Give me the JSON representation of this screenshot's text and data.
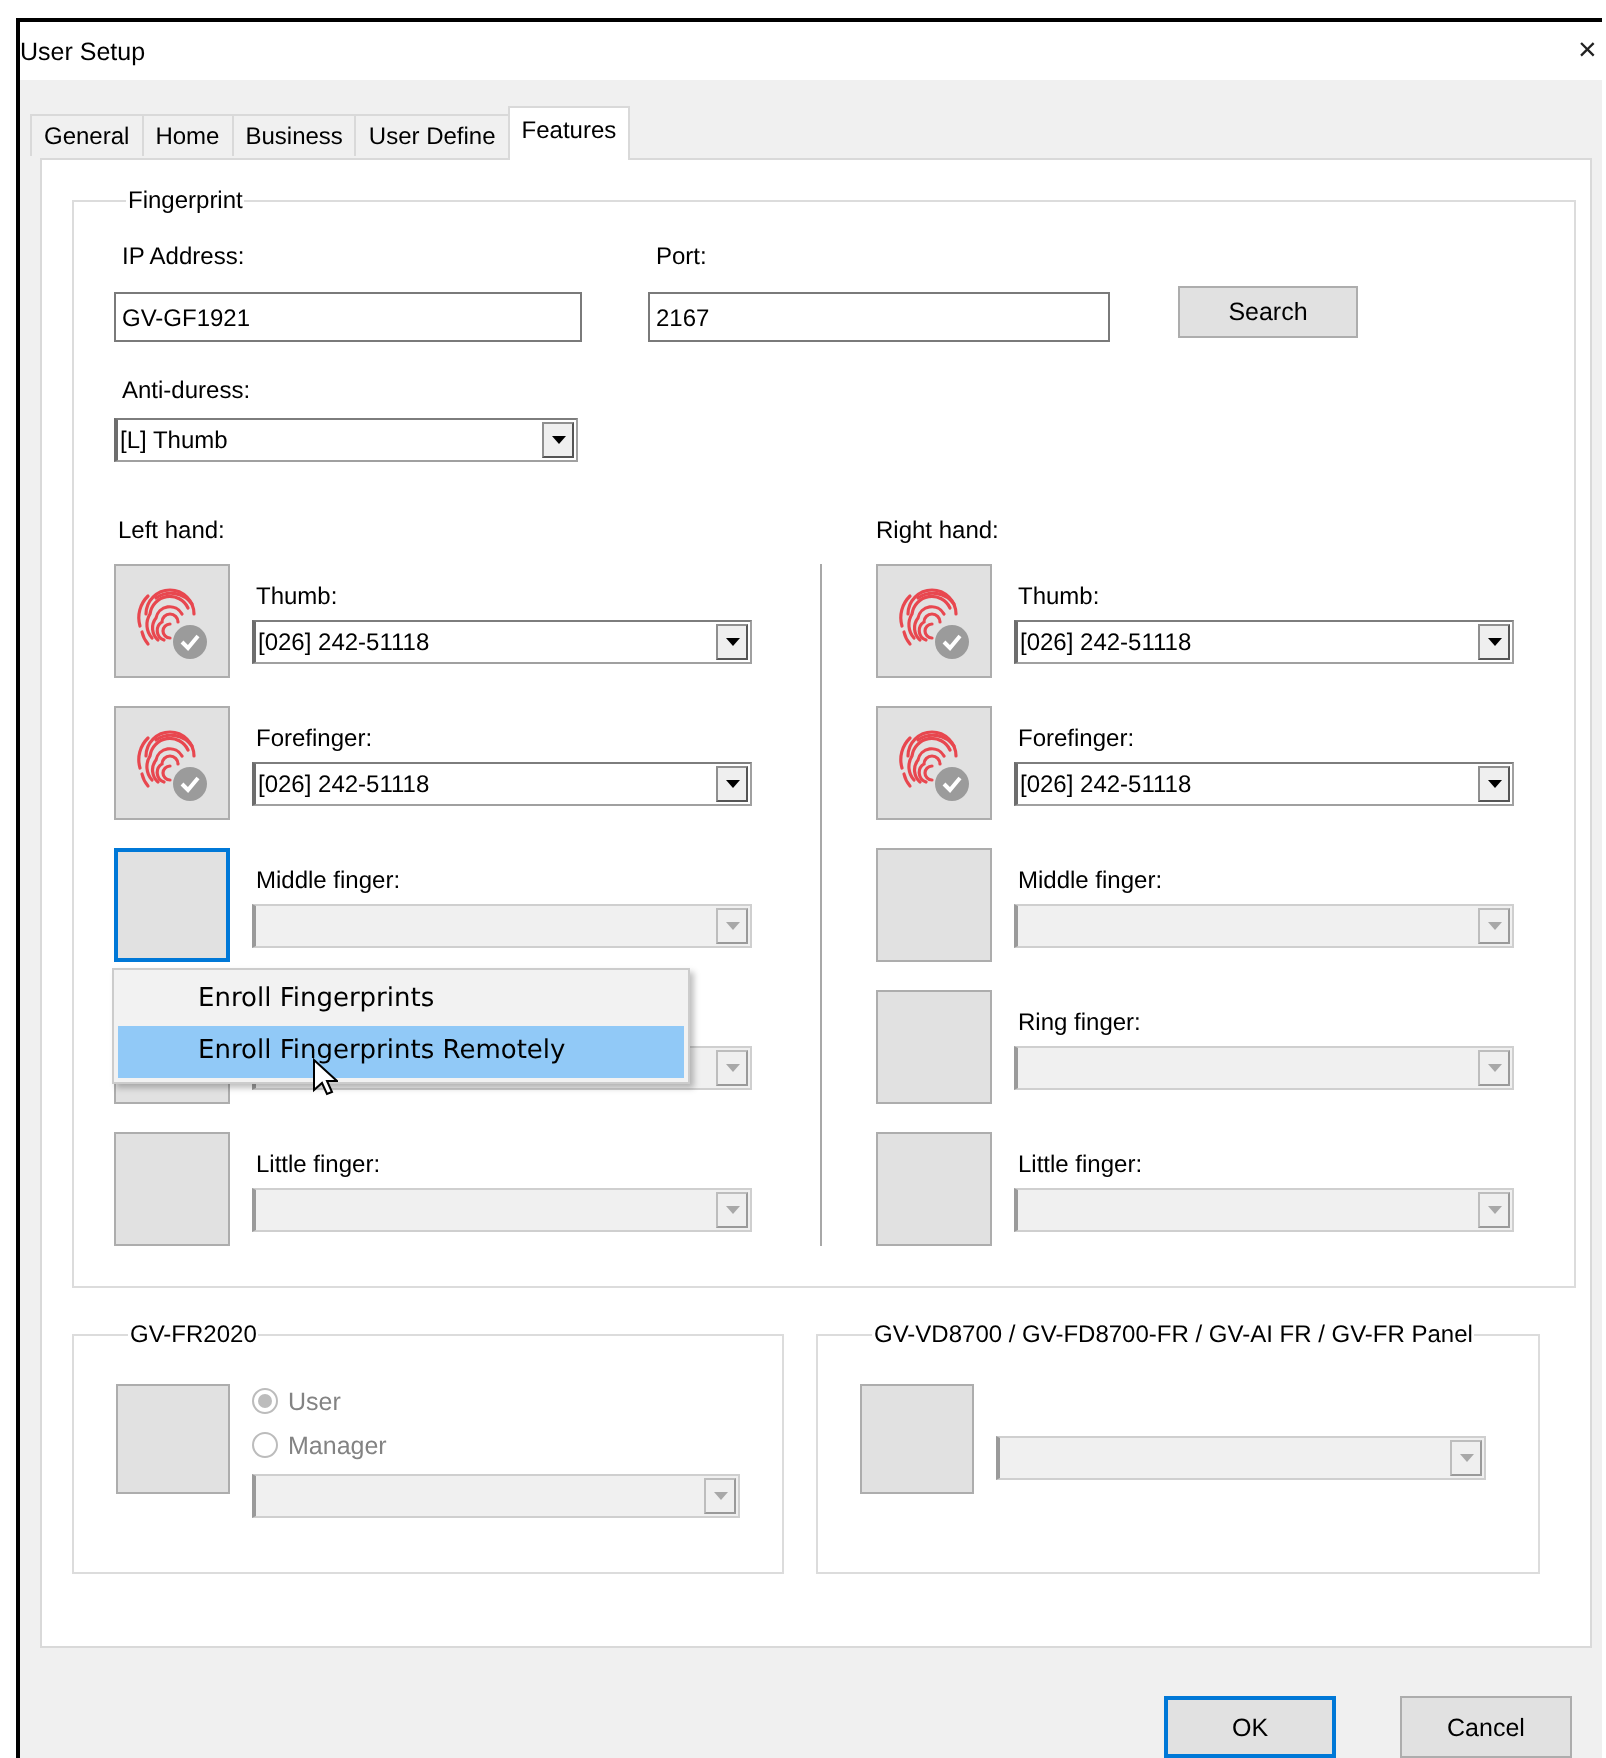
{
  "window": {
    "title": "User Setup",
    "close": "×"
  },
  "tabs": [
    {
      "label": "General",
      "selected": false
    },
    {
      "label": "Home",
      "selected": false
    },
    {
      "label": "Business",
      "selected": false
    },
    {
      "label": "User Define",
      "selected": false
    },
    {
      "label": "Features",
      "selected": true
    }
  ],
  "fingerprint": {
    "title": "Fingerprint",
    "ip_address": {
      "label": "IP Address:",
      "value": "GV-GF1921"
    },
    "port": {
      "label": "Port:",
      "value": "2167"
    },
    "search_button": "Search",
    "anti_duress": {
      "label": "Anti-duress:",
      "value": "[L] Thumb"
    },
    "hands": [
      {
        "label": "Left hand:",
        "fingers": [
          {
            "label": "Thumb:",
            "value": "[026] 242-51118",
            "enrolled": true,
            "disabled": false,
            "focused": false
          },
          {
            "label": "Forefinger:",
            "value": "[026] 242-51118",
            "enrolled": true,
            "disabled": false,
            "focused": false
          },
          {
            "label": "Middle finger:",
            "enrolled": false,
            "disabled": true,
            "focused": true
          },
          {
            "enrolled": false,
            "disabled": true,
            "focused": false
          },
          {
            "label": "Little finger:",
            "enrolled": false,
            "disabled": true,
            "focused": false
          }
        ]
      },
      {
        "label": "Right hand:",
        "fingers": [
          {
            "label": "Thumb:",
            "value": "[026] 242-51118",
            "enrolled": true,
            "disabled": false,
            "focused": false
          },
          {
            "label": "Forefinger:",
            "value": "[026] 242-51118",
            "enrolled": true,
            "disabled": false,
            "focused": false
          },
          {
            "label": "Middle finger:",
            "enrolled": false,
            "disabled": true,
            "focused": false
          },
          {
            "label": "Ring finger:",
            "enrolled": false,
            "disabled": true,
            "focused": false
          },
          {
            "label": "Little finger:",
            "enrolled": false,
            "disabled": true,
            "focused": false
          }
        ]
      }
    ]
  },
  "context_menu": {
    "items": [
      {
        "label": "Enroll Fingerprints",
        "selected": false
      },
      {
        "label": "Enroll Fingerprints Remotely",
        "selected": true
      }
    ]
  },
  "fr2020": {
    "title": "GV-FR2020",
    "disabled": true,
    "roles": [
      {
        "label": "User",
        "selected": true
      },
      {
        "label": "Manager",
        "selected": false
      }
    ]
  },
  "vd8700": {
    "title": "GV-VD8700 / GV-FD8700-FR / GV-AI FR / GV-FR Panel",
    "disabled": true
  },
  "buttons": [
    {
      "label": "OK",
      "default": true
    },
    {
      "label": "Cancel",
      "default": false
    }
  ]
}
